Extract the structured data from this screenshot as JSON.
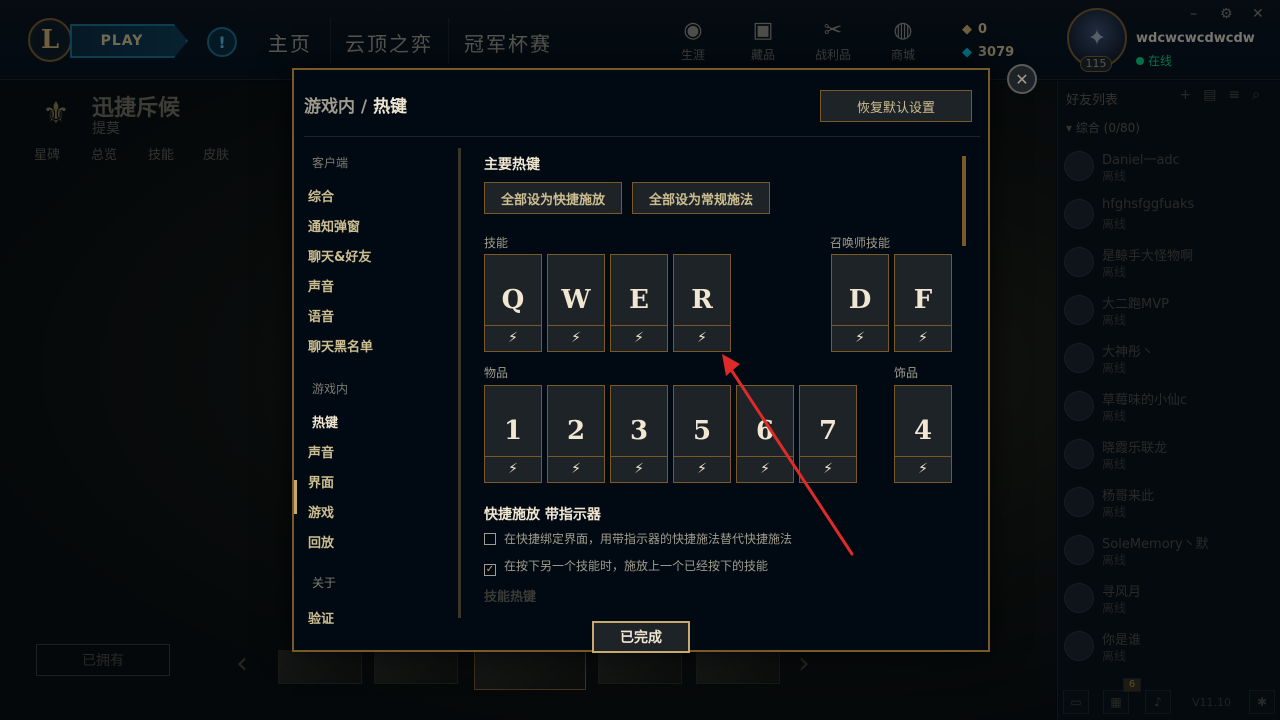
{
  "topbar": {
    "logo": "L",
    "play_label": "PLAY",
    "alert": "!",
    "tabs": [
      "主页",
      "云顶之弈",
      "冠军杯赛"
    ],
    "icons": [
      {
        "label": "生涯",
        "icon": "profile-icon"
      },
      {
        "label": "藏品",
        "icon": "collection-icon"
      },
      {
        "label": "战利品",
        "icon": "loot-icon"
      },
      {
        "label": "商城",
        "icon": "store-icon"
      }
    ],
    "currency": {
      "blue_essence": "0",
      "riot_points": "3079"
    },
    "profile": {
      "username": "wdcwcwcdwcdw",
      "status": "在线",
      "level": "115"
    },
    "window_controls": [
      "–",
      "⚙",
      "✕"
    ]
  },
  "background": {
    "champion": {
      "name": "迅捷斥候",
      "subtitle": "提莫",
      "tabs": [
        "星碑",
        "总览",
        "技能",
        "皮肤"
      ]
    },
    "owned_label": "已拥有"
  },
  "friends": {
    "title": "好友列表",
    "group": "综合 (0/80)",
    "list": [
      {
        "name": "Daniel一adc",
        "status": "离线"
      },
      {
        "name": "hfghsfggfuaks",
        "status": "离线"
      },
      {
        "name": "是鲸手大怪物啊",
        "status": "离线"
      },
      {
        "name": "大二跑MVP",
        "status": "离线"
      },
      {
        "name": "大神彤丶",
        "status": "离线"
      },
      {
        "name": "草莓味的小仙c",
        "status": "离线"
      },
      {
        "name": "晓霞乐联龙",
        "status": "离线"
      },
      {
        "name": "杨哥来此",
        "status": "离线"
      },
      {
        "name": "SoleMemory丶默",
        "status": "离线"
      },
      {
        "name": "寻风月",
        "status": "离线"
      },
      {
        "name": "你是谁",
        "status": "离线"
      }
    ],
    "badge_count": "6",
    "version": "V11.10"
  },
  "modal": {
    "breadcrumb_parent": "游戏内",
    "breadcrumb_sep": "/",
    "breadcrumb_current": "热键",
    "restore_label": "恢复默认设置",
    "done_label": "已完成",
    "nav": {
      "client_header": "客户端",
      "client_items": [
        "综合",
        "通知弹窗",
        "聊天&好友",
        "声音",
        "语音",
        "聊天黑名单"
      ],
      "ingame_header": "游戏内",
      "ingame_items": [
        "热键",
        "声音",
        "界面",
        "游戏",
        "回放"
      ],
      "about_header": "关于",
      "about_items": [
        "验证"
      ]
    },
    "hotkeys": {
      "title": "主要热键",
      "btn_quick": "全部设为快捷施放",
      "btn_normal": "全部设为常规施法",
      "abilities_label": "技能",
      "abilities": [
        "Q",
        "W",
        "E",
        "R"
      ],
      "summoner_label": "召唤师技能",
      "summoners": [
        "D",
        "F"
      ],
      "items_label": "物品",
      "items": [
        "1",
        "2",
        "3",
        "5",
        "6",
        "7"
      ],
      "trinket_label": "饰品",
      "trinket": "4",
      "quickcast_flag": "⚡"
    },
    "quickcast": {
      "title": "快捷施放 带指示器",
      "options": [
        {
          "label": "在快捷绑定界面，用带指示器的快捷施法替代快捷施法",
          "checked": false
        },
        {
          "label": "在按下另一个技能时，施放上一个已经按下的技能",
          "checked": true
        }
      ],
      "next_section": "技能热键"
    }
  },
  "colors": {
    "gold": "#c8aa6e",
    "gold_dark": "#785a28",
    "text_light": "#f0e6d2",
    "panel": "#1e2328",
    "annotation_arrow": "#e02a2a"
  }
}
